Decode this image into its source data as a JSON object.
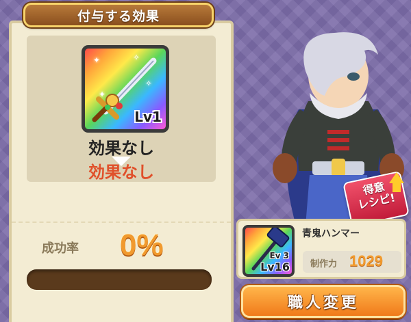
{
  "effect_panel": {
    "title": "付与する効果",
    "item": {
      "level": "Lv1",
      "icon": "sword-icon"
    },
    "current_effect": "効果なし",
    "new_effect": "効果なし",
    "success_rate_label": "成功率",
    "success_rate_value": "0%",
    "success_progress": 0
  },
  "recipe_badge": {
    "line1": "得意",
    "line2": "レシピ!"
  },
  "crafter": {
    "name": "青鬼ハンマー",
    "icon": "hammer-icon",
    "ev": "Ev 3",
    "level": "Lv16",
    "craft_power_label": "制作力",
    "craft_power_value": "1029"
  },
  "actions": {
    "change_button": "職人変更"
  },
  "colors": {
    "accent_orange": "#f19a2e",
    "new_effect_red": "#e0502a",
    "title_brown": "#8a4f1e",
    "panel_cream": "#f3ecd3"
  }
}
